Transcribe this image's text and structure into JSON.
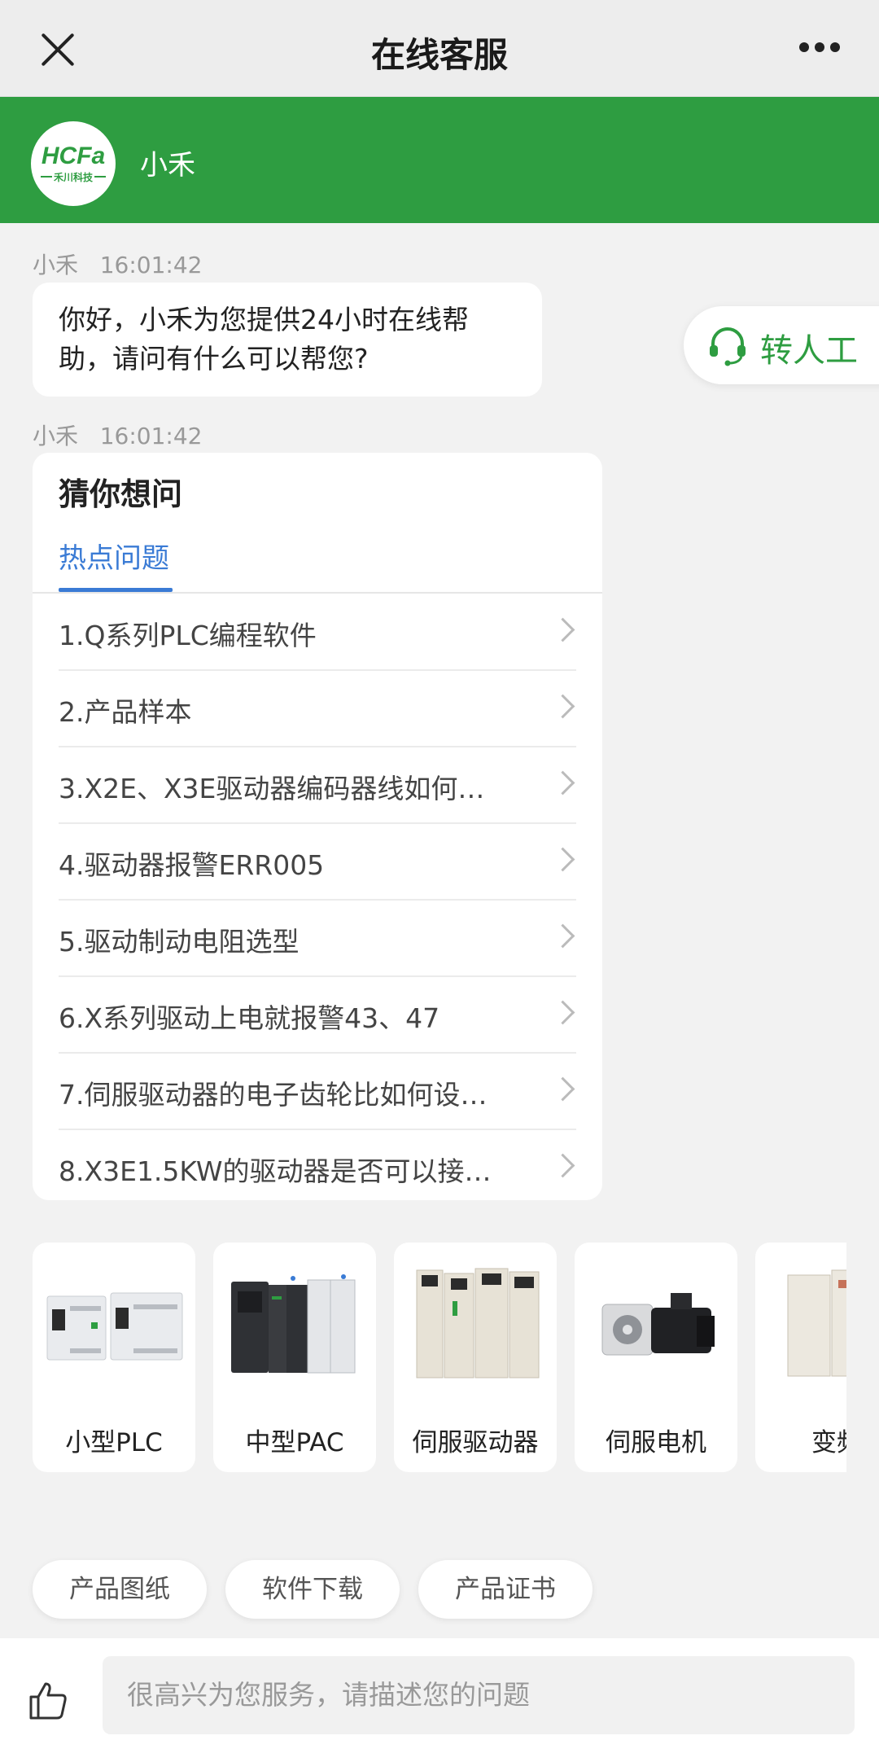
{
  "header": {
    "title": "在线客服"
  },
  "agent": {
    "name": "小禾",
    "logo_text": "HCFa",
    "logo_sub": "禾川科技"
  },
  "messages": [
    {
      "sender": "小禾",
      "time": "16:01:42",
      "text": "你好，小禾为您提供24小时在线帮助，请问有什么可以帮您?"
    },
    {
      "sender": "小禾",
      "time": "16:01:42"
    }
  ],
  "transfer_button": {
    "label": "转人工"
  },
  "faq": {
    "title": "猜你想问",
    "tab": "热点问题",
    "items": [
      "1.Q系列PLC编程软件",
      "2.产品样本",
      "3.X2E、X3E驱动器编码器线如何…",
      "4.驱动器报警ERR005",
      "5.驱动制动电阻选型",
      "6.X系列驱动上电就报警43、47",
      "7.伺服驱动器的电子齿轮比如何设…",
      "8.X3E1.5KW的驱动器是否可以接…"
    ]
  },
  "products": [
    "小型PLC",
    "中型PAC",
    "伺服驱动器",
    "伺服电机",
    "变频"
  ],
  "quick_links": [
    "产品图纸",
    "软件下载",
    "产品证书"
  ],
  "input": {
    "placeholder": "很高兴为您服务，请描述您的问题"
  },
  "colors": {
    "brand_green": "#2e9d41",
    "link_blue": "#3a7bd5"
  }
}
